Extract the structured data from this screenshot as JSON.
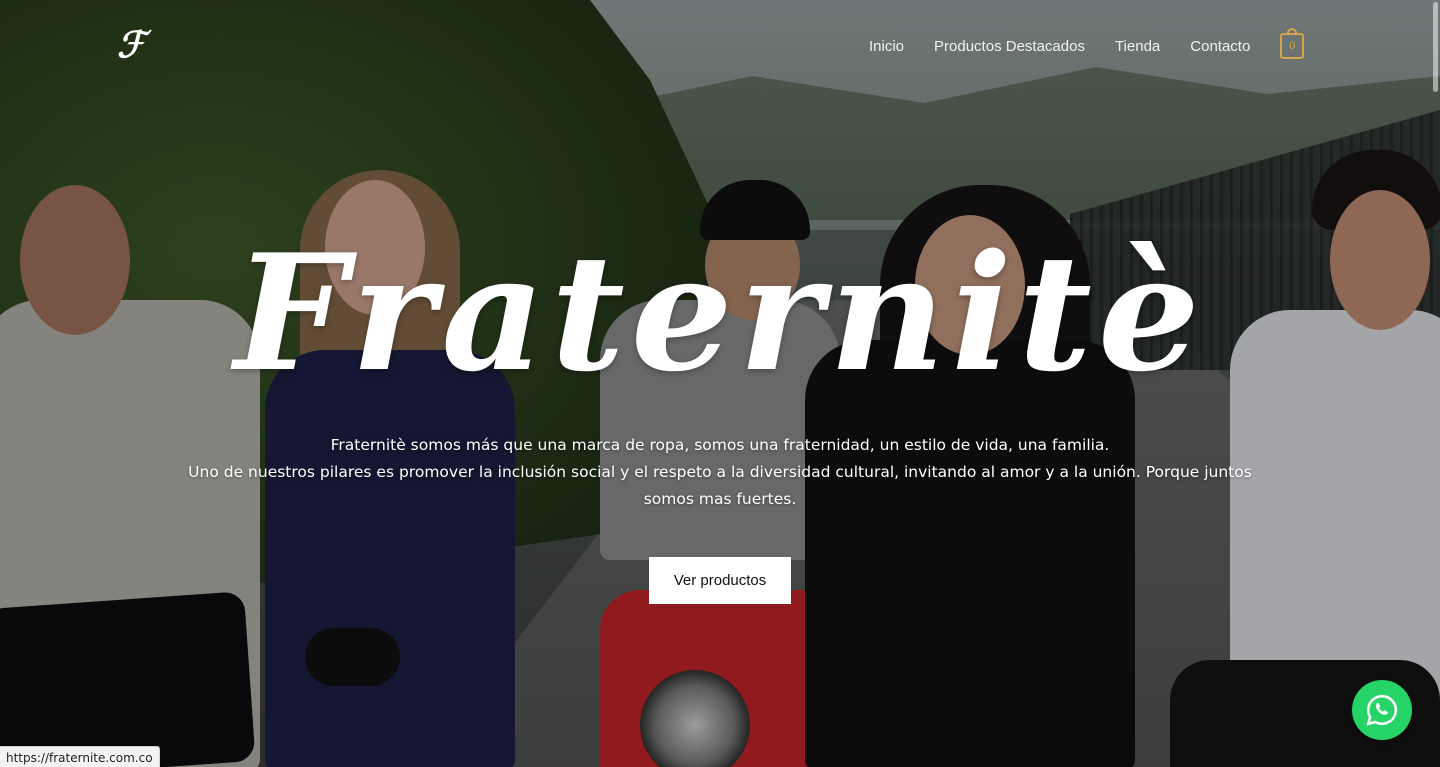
{
  "header": {
    "logo_text": "ℱ",
    "nav": [
      {
        "label": "Inicio"
      },
      {
        "label": "Productos Destacados"
      },
      {
        "label": "Tienda"
      },
      {
        "label": "Contacto"
      }
    ],
    "cart_count": "0"
  },
  "hero": {
    "title": "Fraternitè",
    "paragraph_1": "Fraternitè somos más que una marca de ropa, somos una fraternidad, un estilo de vida, una familia.",
    "paragraph_2": "Uno de nuestros pilares es promover la inclusión social y el respeto a la diversidad cultural, invitando al amor y a la unión. Porque juntos somos mas fuertes.",
    "cta_label": "Ver productos"
  },
  "status_bar": {
    "url": "https://fraternite.com.co"
  },
  "colors": {
    "cart_accent": "#d8a44a",
    "whatsapp": "#25d366",
    "cta_bg": "#ffffff"
  },
  "icons": {
    "cart": "shopping-bag-icon",
    "whatsapp": "whatsapp-icon"
  }
}
